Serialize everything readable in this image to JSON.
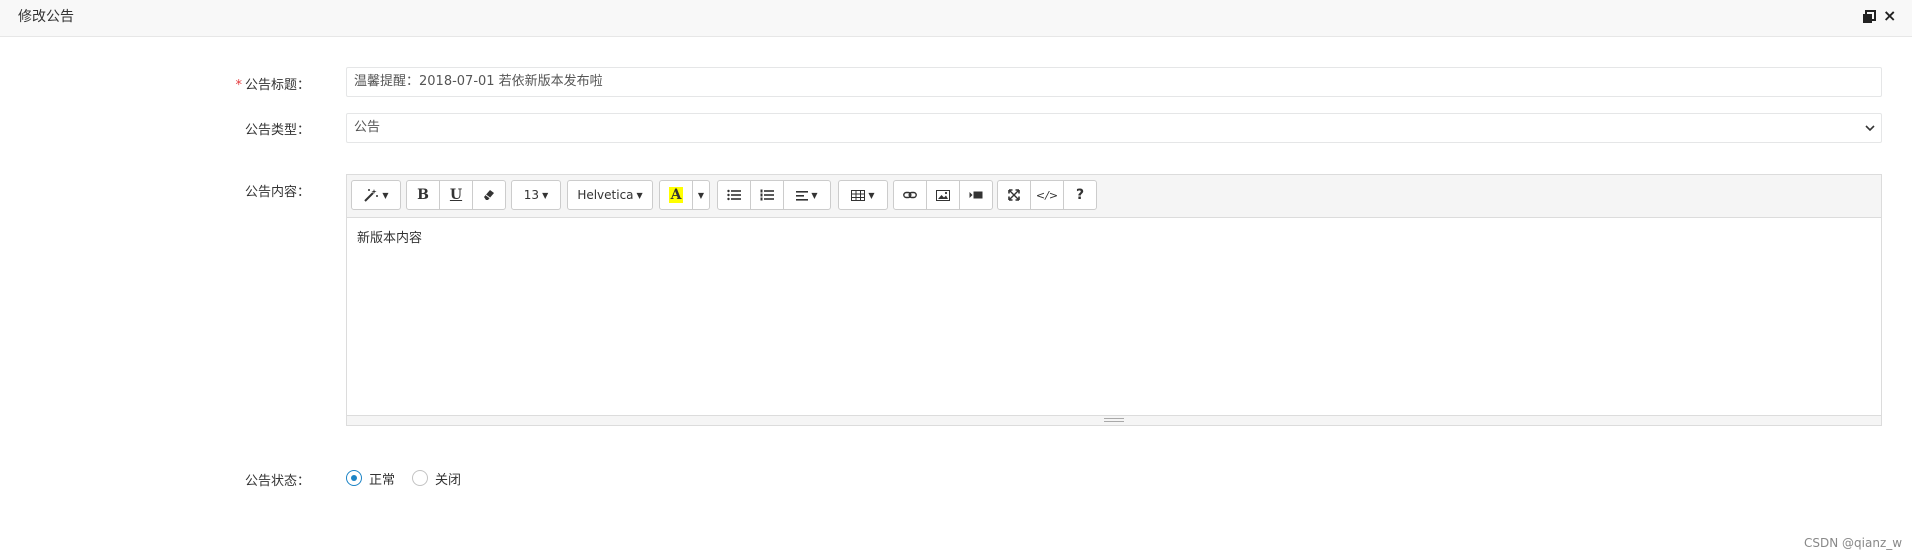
{
  "window": {
    "title": "修改公告",
    "maximize_icon": "restore-icon",
    "close_label": "×"
  },
  "form": {
    "title_label": "公告标题：",
    "title_required_mark": "*",
    "title_value": "温馨提醒：2018-07-01 若依新版本发布啦",
    "type_label": "公告类型：",
    "type_value": "公告",
    "content_label": "公告内容：",
    "status_label": "公告状态：",
    "status_options": [
      {
        "label": "正常",
        "selected": true
      },
      {
        "label": "关闭",
        "selected": false
      }
    ]
  },
  "editor": {
    "toolbar": {
      "style_icon": "magic-wand-icon",
      "bold_label": "B",
      "underline_label": "U",
      "eraser_icon": "eraser-icon",
      "font_size": "13",
      "font_name": "Helvetica",
      "color_label": "A",
      "highlight_color": "#ffff00",
      "ul_icon": "unordered-list-icon",
      "ol_icon": "ordered-list-icon",
      "align_icon": "align-left-icon",
      "table_icon": "table-icon",
      "link_icon": "link-icon",
      "picture_icon": "picture-icon",
      "video_icon": "video-icon",
      "fullscreen_icon": "fullscreen-icon",
      "code_label": "</>",
      "help_label": "?"
    },
    "content": "新版本内容"
  },
  "watermark": "CSDN @qianz_w",
  "colors": {
    "accent": "#1c84c6",
    "required": "#e4393c",
    "titlebar_bg": "#f8f8f8"
  }
}
